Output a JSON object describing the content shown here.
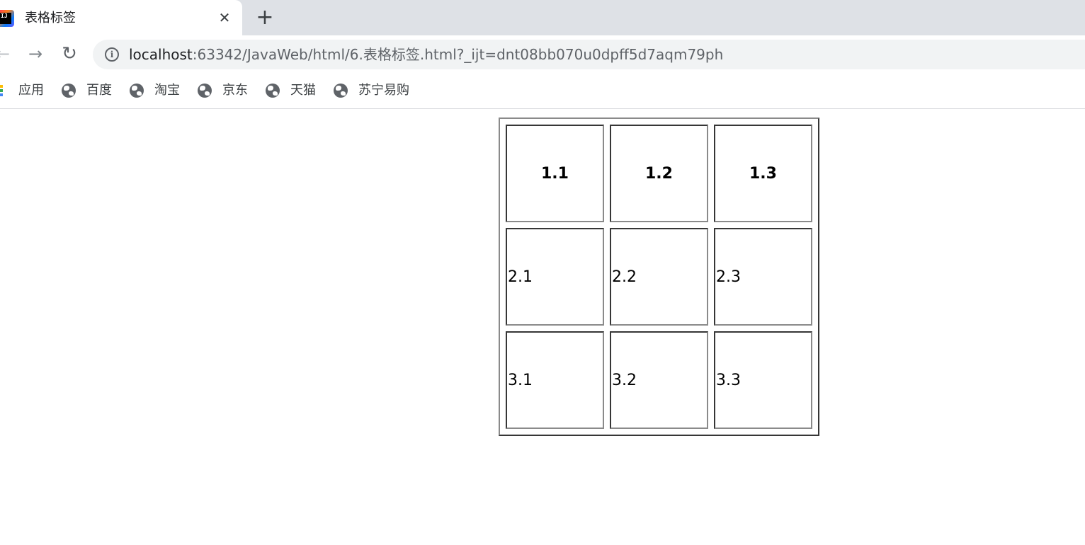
{
  "browser": {
    "tab": {
      "title": "表格标签",
      "favicon_text": "IJ",
      "close_glyph": "✕"
    },
    "new_tab_glyph": "+",
    "nav": {
      "back_glyph": "←",
      "forward_glyph": "→",
      "reload_glyph": "↻"
    },
    "omnibox": {
      "info_glyph": "i",
      "url_host": "localhost",
      "url_rest": ":63342/JavaWeb/html/6.表格标签.html?_ijt=dnt08bb070u0dpff5d7aqm79ph"
    },
    "bookmarks": [
      {
        "label": "应用",
        "icon": "apps-icon"
      },
      {
        "label": "百度",
        "icon": "globe-icon"
      },
      {
        "label": "淘宝",
        "icon": "globe-icon"
      },
      {
        "label": "京东",
        "icon": "globe-icon"
      },
      {
        "label": "天猫",
        "icon": "globe-icon"
      },
      {
        "label": "苏宁易购",
        "icon": "globe-icon"
      }
    ]
  },
  "table": {
    "header": [
      "1.1",
      "1.2",
      "1.3"
    ],
    "rows": [
      [
        "2.1",
        "2.2",
        "2.3"
      ],
      [
        "3.1",
        "3.2",
        "3.3"
      ]
    ]
  },
  "colors": {
    "tabstrip": "#dee1e6",
    "omnibox": "#f1f3f4",
    "icon_gray": "#5f6368"
  }
}
